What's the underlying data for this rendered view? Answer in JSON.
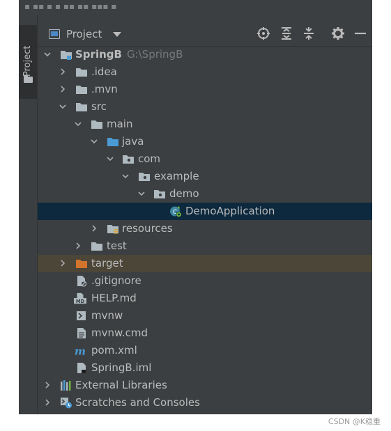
{
  "sidebar_tab": {
    "label": "Project"
  },
  "header": {
    "title": "Project"
  },
  "tree": [
    {
      "label": "SpringB",
      "path": "G:\\SpringB",
      "level": 0,
      "expanded": true,
      "icon": "module-folder-icon",
      "bold": true
    },
    {
      "label": ".idea",
      "level": 1,
      "expanded": false,
      "icon": "folder-icon"
    },
    {
      "label": ".mvn",
      "level": 1,
      "expanded": false,
      "icon": "folder-icon"
    },
    {
      "label": "src",
      "level": 1,
      "expanded": true,
      "icon": "folder-icon"
    },
    {
      "label": "main",
      "level": 2,
      "expanded": true,
      "icon": "folder-icon"
    },
    {
      "label": "java",
      "level": 3,
      "expanded": true,
      "icon": "source-folder-icon"
    },
    {
      "label": "com",
      "level": 4,
      "expanded": true,
      "icon": "package-icon"
    },
    {
      "label": "example",
      "level": 5,
      "expanded": true,
      "icon": "package-icon"
    },
    {
      "label": "demo",
      "level": 6,
      "expanded": true,
      "icon": "package-icon"
    },
    {
      "label": "DemoApplication",
      "level": 8,
      "icon": "spring-class-icon",
      "selected": true
    },
    {
      "label": "resources",
      "level": 3,
      "expanded": false,
      "icon": "resources-folder-icon"
    },
    {
      "label": "test",
      "level": 2,
      "expanded": false,
      "icon": "folder-icon"
    },
    {
      "label": "target",
      "level": 1,
      "expanded": false,
      "icon": "excluded-folder-icon",
      "excluded": true
    },
    {
      "label": ".gitignore",
      "level": 1,
      "icon": "ignore-file-icon"
    },
    {
      "label": "HELP.md",
      "level": 1,
      "icon": "markdown-file-icon"
    },
    {
      "label": "mvnw",
      "level": 1,
      "icon": "shell-file-icon"
    },
    {
      "label": "mvnw.cmd",
      "level": 1,
      "icon": "text-file-icon"
    },
    {
      "label": "pom.xml",
      "level": 1,
      "icon": "maven-icon"
    },
    {
      "label": "SpringB.iml",
      "level": 1,
      "icon": "iml-file-icon"
    },
    {
      "label": "External Libraries",
      "level": 0,
      "expanded": false,
      "icon": "libraries-icon"
    },
    {
      "label": "Scratches and Consoles",
      "level": 0,
      "expanded": false,
      "icon": "scratches-icon"
    }
  ],
  "watermark": "CSDN @K稳重",
  "colors": {
    "panel_bg": "#3c3f41",
    "selected_row": "#0d293e",
    "excluded_row": "#4c4638",
    "text": "#bbbbbb",
    "folder": "#aeb9c0",
    "source_folder": "#4a9ad4",
    "excluded_folder": "#d2742c"
  }
}
